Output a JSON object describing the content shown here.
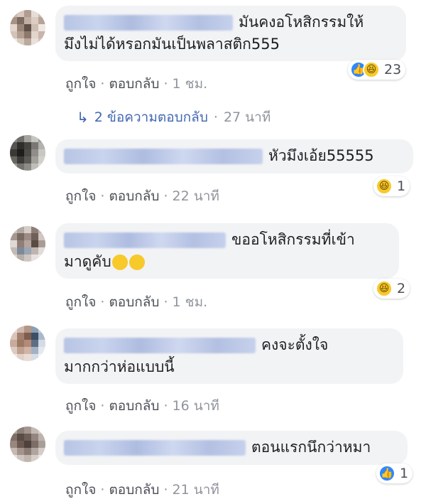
{
  "comments": [
    {
      "text_line1": "มันคงอโหสิกรรมให้",
      "text_line2": "มึงไม่ได้หรอกมันเป็นพลาสติก555",
      "actions": {
        "like": "ถูกใจ",
        "reply": "ตอบกลับ",
        "time": "1 ชม."
      },
      "reactions": {
        "types": [
          "like-icon",
          "haha-icon"
        ],
        "count": "23"
      },
      "replies": {
        "label": "2 ข้อความตอบกลับ",
        "time": "27 นาที"
      }
    },
    {
      "text_line1": "หัวมึงเอ้ย55555",
      "actions": {
        "like": "ถูกใจ",
        "reply": "ตอบกลับ",
        "time": "22 นาที"
      },
      "reactions": {
        "types": [
          "haha-icon"
        ],
        "count": "1"
      }
    },
    {
      "text_line1": "ขออโหสิกรรมที่เข้า",
      "text_line2": "มาดูคับ",
      "actions": {
        "like": "ถูกใจ",
        "reply": "ตอบกลับ",
        "time": "1 ชม."
      },
      "reactions": {
        "types": [
          "haha-icon"
        ],
        "count": "2"
      }
    },
    {
      "text_line1": "คงจะตั้งใจ",
      "text_line2": "มากกว่าห่อแบบนี้",
      "actions": {
        "like": "ถูกใจ",
        "reply": "ตอบกลับ",
        "time": "16 นาที"
      }
    },
    {
      "text_line1": "ตอนแรกนึกว่าหมา",
      "actions": {
        "like": "ถูกใจ",
        "reply": "ตอบกลับ",
        "time": "21 นาที"
      },
      "reactions": {
        "types": [
          "like-icon"
        ],
        "count": "1"
      }
    }
  ],
  "colors": {
    "bubble": "#f2f3f5",
    "link": "#4267b2",
    "meta": "#90949c",
    "like": "#2d88ff",
    "haha": "#f7c92b"
  }
}
